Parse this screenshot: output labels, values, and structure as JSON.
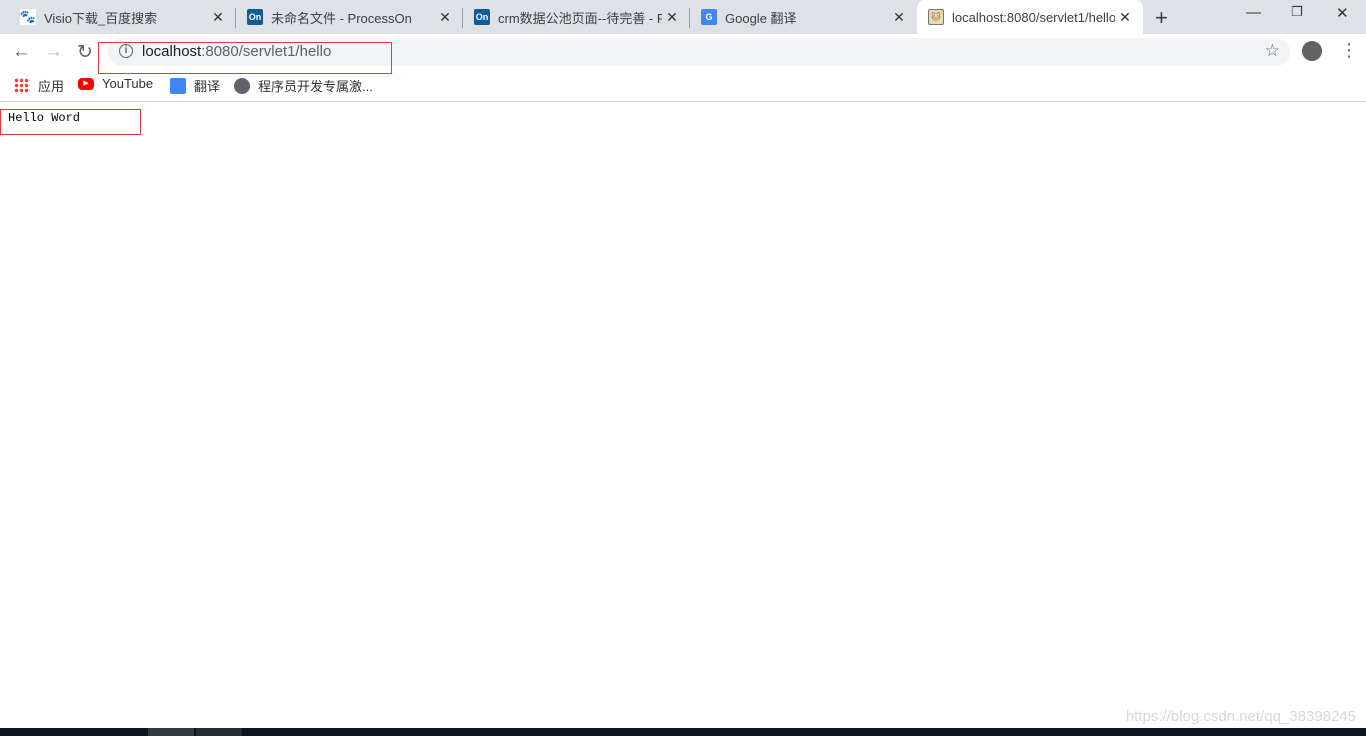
{
  "tabs": [
    {
      "title": "Visio下载_百度搜索",
      "icon": "baidu-paw-icon"
    },
    {
      "title": "未命名文件 - ProcessOn",
      "icon": "processon-icon",
      "badge": "On"
    },
    {
      "title": "crm数据公池页面--待完善 - Pr",
      "icon": "processon-icon",
      "badge": "On"
    },
    {
      "title": "Google 翻译",
      "icon": "google-translate-icon",
      "badge": "G"
    },
    {
      "title": "localhost:8080/servlet1/hello",
      "icon": "tomcat-icon"
    }
  ],
  "address": {
    "host": "localhost",
    "rest": ":8080/servlet1/hello"
  },
  "bookmarks": [
    {
      "label": "应用"
    },
    {
      "label": "YouTube"
    },
    {
      "label": "翻译"
    },
    {
      "label": "程序员开发专属激..."
    }
  ],
  "page": {
    "text": "Hello Word"
  },
  "watermark": "https://blog.csdn.net/qq_38398245",
  "colors": {
    "highlight": "#e53935",
    "tabstrip": "#dee1e6"
  }
}
